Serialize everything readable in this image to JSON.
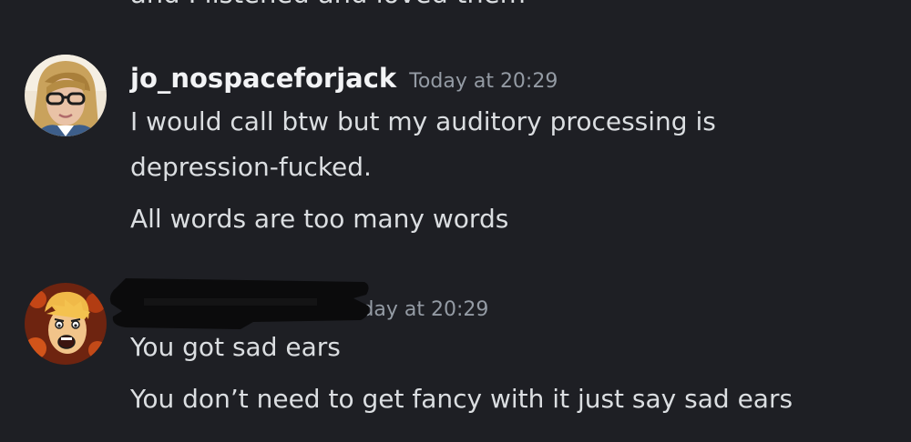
{
  "previous_message": {
    "cut_text": "and I listened and loved them"
  },
  "messages": [
    {
      "username": "jo_nospaceforjack",
      "timestamp": "Today at 20:29",
      "lines": [
        "I would call btw but my auditory processing is",
        "depression-fucked.",
        "All words are too many words"
      ]
    },
    {
      "username": "",
      "timestamp": "oday at 20:29",
      "lines": [
        "You got sad ears",
        "You don’t need to get fancy with it just say sad ears"
      ]
    }
  ],
  "colors": {
    "background": "#1e1f24",
    "username": "#f2f3f5",
    "timestamp": "#949ba4",
    "text": "#dbdee1"
  }
}
